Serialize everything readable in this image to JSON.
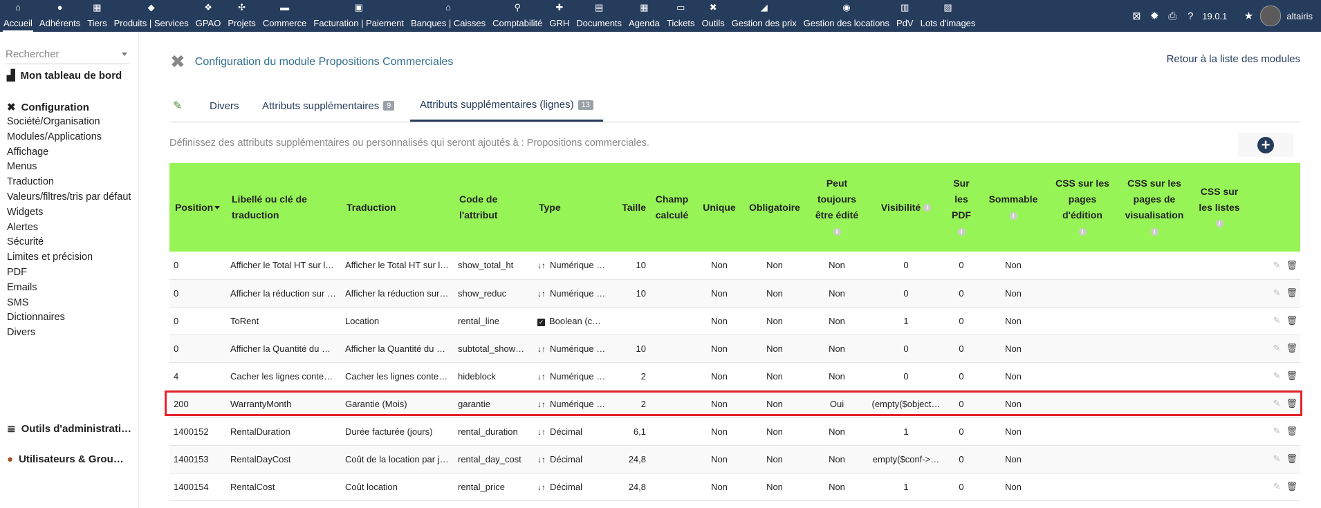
{
  "topmenu": [
    {
      "icon": "home-icon",
      "glyph": "⌂",
      "label": "Accueil"
    },
    {
      "icon": "user-icon",
      "glyph": "●",
      "label": "Adhérents"
    },
    {
      "icon": "building-icon",
      "glyph": "▦",
      "label": "Tiers"
    },
    {
      "icon": "cube-icon",
      "glyph": "◆",
      "label": "Produits | Services"
    },
    {
      "icon": "cubes-icon",
      "glyph": "❖",
      "label": "GPAO"
    },
    {
      "icon": "project-icon",
      "glyph": "✣",
      "label": "Projets"
    },
    {
      "icon": "briefcase-icon",
      "glyph": "▬",
      "label": "Commerce"
    },
    {
      "icon": "invoice-icon",
      "glyph": "▣",
      "label": "Facturation | Paiement"
    },
    {
      "icon": "bank-icon",
      "glyph": "⌂",
      "label": "Banques | Caisses"
    },
    {
      "icon": "search-dollar-icon",
      "glyph": "⚲",
      "label": "Comptabilité"
    },
    {
      "icon": "hrm-icon",
      "glyph": "✚",
      "label": "GRH"
    },
    {
      "icon": "file-icon",
      "glyph": "▤",
      "label": "Documents"
    },
    {
      "icon": "calendar-icon",
      "glyph": "▦",
      "label": "Agenda"
    },
    {
      "icon": "ticket-icon",
      "glyph": "▭",
      "label": "Tickets"
    },
    {
      "icon": "tools-icon",
      "glyph": "✖",
      "label": "Outils"
    },
    {
      "icon": "price-icon",
      "glyph": "◢",
      "label": "Gestion des prix"
    },
    {
      "icon": "rental-icon",
      "glyph": "◉",
      "label": "Gestion des locations"
    },
    {
      "icon": "pos-icon",
      "glyph": "▥",
      "label": "PdV"
    },
    {
      "icon": "images-icon",
      "glyph": "▨",
      "label": "Lots d'images"
    }
  ],
  "topright": {
    "version": "19.0.1",
    "username": "altairis"
  },
  "sidebar": {
    "search_placeholder": "Rechercher",
    "dashboard": "Mon tableau de bord",
    "configuration": "Configuration",
    "items": [
      "Société/Organisation",
      "Modules/Applications",
      "Affichage",
      "Menus",
      "Traduction",
      "Valeurs/filtres/tris par défaut",
      "Widgets",
      "Alertes",
      "Sécurité",
      "Limites et précision",
      "PDF",
      "Emails",
      "SMS",
      "Dictionnaires",
      "Divers"
    ],
    "admin_tools": "Outils d'administrati…",
    "users_groups": "Utilisateurs & Grou…"
  },
  "header": {
    "title": "Configuration du module Propositions Commerciales",
    "back_link": "Retour à la liste des modules"
  },
  "tabs": [
    {
      "label": "Divers",
      "badge": ""
    },
    {
      "label": "Attributs supplémentaires",
      "badge": "9"
    },
    {
      "label": "Attributs supplémentaires (lignes)",
      "badge": "13"
    }
  ],
  "description": "Définissez des attributs supplémentaires ou personnalisés qui seront ajoutés à : Propositions commerciales.",
  "columns": [
    "Position",
    "Libellé ou clé de traduction",
    "Traduction",
    "Code de l'attribut",
    "Type",
    "Taille",
    "Champ calculé",
    "Unique",
    "Obligatoire",
    "Peut toujours être édité",
    "Visibilité",
    "Sur les PDF",
    "Sommable",
    "CSS sur les pages d'édition",
    "CSS sur les pages de visualisation",
    "CSS sur les listes"
  ],
  "rows": [
    {
      "position": "0",
      "label": "Afficher le Total HT sur l…",
      "translation": "Afficher le Total HT sur l…",
      "code": "show_total_ht",
      "type": "Numérique …",
      "type_icon": "sort-numeric-icon",
      "size": "10",
      "computed": "",
      "unique": "Non",
      "required": "Non",
      "editable": "Non",
      "visibility": "0",
      "pdf": "0",
      "summable": "Non"
    },
    {
      "position": "0",
      "label": "Afficher la réduction sur …",
      "translation": "Afficher la réduction sur…",
      "code": "show_reduc",
      "type": "Numérique …",
      "type_icon": "sort-numeric-icon",
      "size": "10",
      "computed": "",
      "unique": "Non",
      "required": "Non",
      "editable": "Non",
      "visibility": "0",
      "pdf": "0",
      "summable": "Non"
    },
    {
      "position": "0",
      "label": "ToRent",
      "translation": "Location",
      "code": "rental_line",
      "type": "Boolean (c…",
      "type_icon": "checkbox-icon",
      "size": "",
      "computed": "",
      "unique": "Non",
      "required": "Non",
      "editable": "Non",
      "visibility": "1",
      "pdf": "0",
      "summable": "Non"
    },
    {
      "position": "0",
      "label": "Afficher la Quantité du …",
      "translation": "Afficher la Quantité du …",
      "code": "subtotal_show…",
      "type": "Numérique …",
      "type_icon": "sort-numeric-icon",
      "size": "10",
      "computed": "",
      "unique": "Non",
      "required": "Non",
      "editable": "Non",
      "visibility": "0",
      "pdf": "0",
      "summable": "Non"
    },
    {
      "position": "4",
      "label": "Cacher les lignes conte…",
      "translation": "Cacher les lignes conte…",
      "code": "hideblock",
      "type": "Numérique …",
      "type_icon": "sort-numeric-icon",
      "size": "2",
      "computed": "",
      "unique": "Non",
      "required": "Non",
      "editable": "Non",
      "visibility": "0",
      "pdf": "0",
      "summable": "Non"
    },
    {
      "position": "200",
      "label": "WarrantyMonth",
      "translation": "Garantie (Mois)",
      "code": "garantie",
      "type": "Numérique …",
      "type_icon": "sort-numeric-icon",
      "size": "2",
      "computed": "",
      "unique": "Non",
      "required": "Non",
      "editable": "Oui",
      "visibility": "(empty($object…",
      "pdf": "0",
      "summable": "Non"
    },
    {
      "position": "1400152",
      "label": "RentalDuration",
      "translation": "Durée facturée (jours)",
      "code": "rental_duration",
      "type": "Décimal",
      "type_icon": "sort-numeric-icon",
      "size": "6,1",
      "computed": "",
      "unique": "Non",
      "required": "Non",
      "editable": "Non",
      "visibility": "1",
      "pdf": "0",
      "summable": "Non"
    },
    {
      "position": "1400153",
      "label": "RentalDayCost",
      "translation": "Coût de la location par j…",
      "code": "rental_day_cost",
      "type": "Décimal",
      "type_icon": "sort-numeric-icon",
      "size": "24,8",
      "computed": "",
      "unique": "Non",
      "required": "Non",
      "editable": "Non",
      "visibility": "empty($conf->…",
      "pdf": "0",
      "summable": "Non"
    },
    {
      "position": "1400154",
      "label": "RentalCost",
      "translation": "Coût location",
      "code": "rental_price",
      "type": "Décimal",
      "type_icon": "sort-numeric-icon",
      "size": "24,8",
      "computed": "",
      "unique": "Non",
      "required": "Non",
      "editable": "Non",
      "visibility": "1",
      "pdf": "0",
      "summable": "Non"
    }
  ],
  "colors": {
    "topbar": "#263c5c",
    "header_row": "#97f456",
    "highlight": "#e3242b",
    "link": "#263c5c"
  }
}
